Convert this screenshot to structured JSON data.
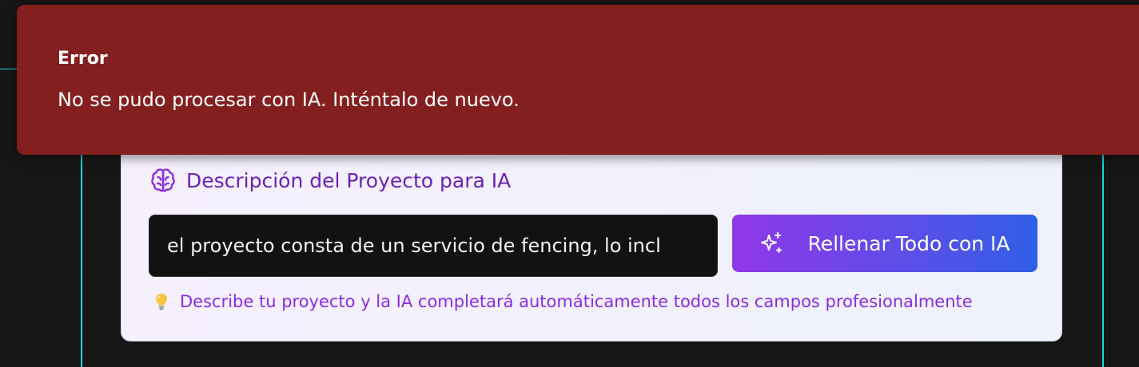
{
  "toast": {
    "title": "Error",
    "message": "No se pudo procesar con IA. Inténtalo de nuevo.",
    "color": "#841f1f"
  },
  "ai_card": {
    "title": "Descripción del Proyecto para IA",
    "title_icon": "brain-icon",
    "input": {
      "value": "el proyecto consta de un servicio de fencing, lo incl"
    },
    "fill_button": {
      "label": "Rellenar Todo con IA",
      "icon": "sparkles-icon"
    },
    "hint": {
      "icon": "lightbulb-icon",
      "text": "Describe tu proyecto y la IA completará automáticamente todos los campos profesionalmente"
    },
    "accent_color": "#6b21b5",
    "button_gradient": [
      "#9137e8",
      "#2f5fe6"
    ]
  },
  "guides": {
    "color": "#1fd4dd"
  }
}
